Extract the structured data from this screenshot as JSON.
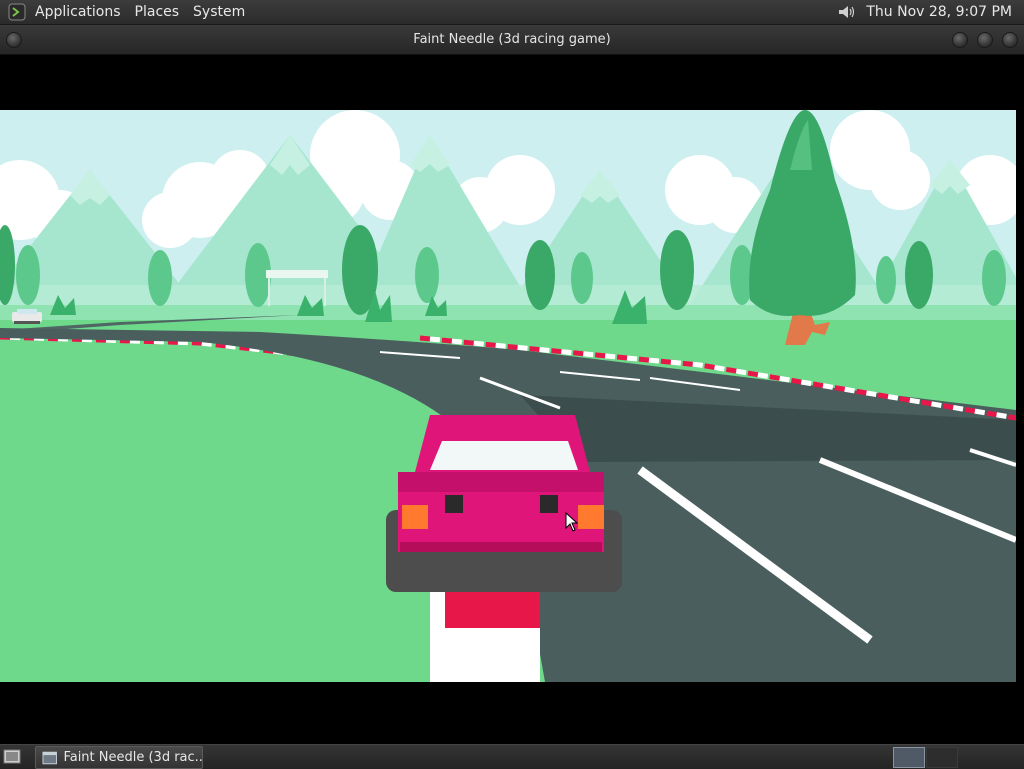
{
  "top_panel": {
    "menus": [
      "Applications",
      "Places",
      "System"
    ],
    "clock": "Thu Nov 28,  9:07 PM"
  },
  "window": {
    "title": "Faint Needle (3d racing game)"
  },
  "taskbar": {
    "task_label": "Faint Needle (3d rac..."
  },
  "icons": {
    "apps": "terminal-logo-icon",
    "volume": "speaker-icon",
    "show_desktop": "show-desktop-icon",
    "task": "window-icon"
  },
  "colors": {
    "sky": "#cdeff0",
    "grass": "#6fd98b",
    "car": "#e0157a",
    "road": "#4a5e5e",
    "tree": "#3aa968",
    "curb_red": "#e8174a"
  }
}
